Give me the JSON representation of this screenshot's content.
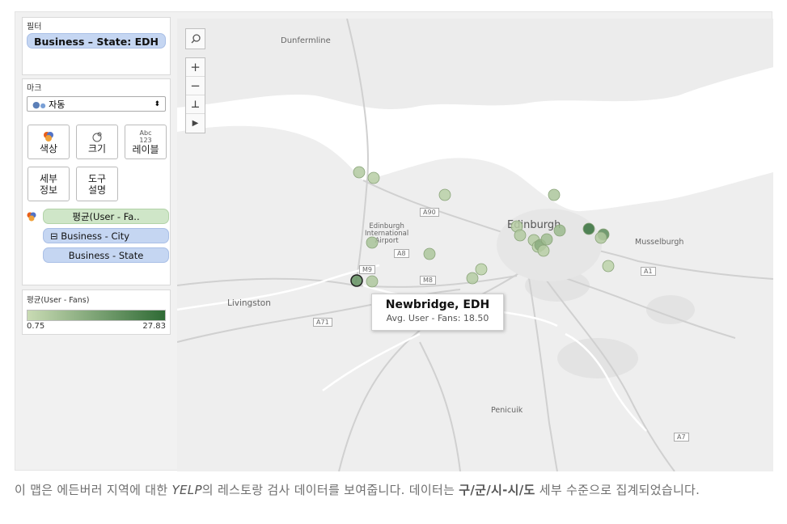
{
  "filters": {
    "title": "필터",
    "pill": "Business – State: EDH"
  },
  "marks": {
    "title": "마크",
    "select_label": "자동",
    "buttons": {
      "color": "색상",
      "size": "크기",
      "label_icon": "Abc\n123",
      "label": "레이블",
      "detail": "세부\n정보",
      "tooltip": "도구\n설명"
    },
    "fields": [
      "평균(User - Fa..",
      "Business - City",
      "Business - State"
    ]
  },
  "legend": {
    "title": "평균(User - Fans)",
    "min": "0.75",
    "max": "27.83",
    "color_low": "#c9dbb4",
    "color_high": "#2f6b35"
  },
  "map_controls": [
    "search-icon",
    "zoom-in",
    "zoom-out",
    "pin",
    "play"
  ],
  "map_labels": {
    "dunfermline": "Dunfermline",
    "edinburgh": "Edinburgh",
    "airport": "Edinburgh\nInternational\nAirport",
    "livingston": "Livingston",
    "musselburgh": "Musselburgh",
    "penicuik": "Penicuik",
    "roads": [
      "A90",
      "A8",
      "M9",
      "M8",
      "A71",
      "A1",
      "A7"
    ]
  },
  "map_data": {
    "points": [
      {
        "city": "Newbridge",
        "state": "EDH",
        "avg_fans": 18.5,
        "selected": true
      },
      {
        "avg_fans": 5.0
      },
      {
        "avg_fans": 4.0
      },
      {
        "avg_fans": 6.5
      },
      {
        "avg_fans": 5.5
      },
      {
        "avg_fans": 6.0
      },
      {
        "avg_fans": 3.5
      },
      {
        "avg_fans": 4.5
      },
      {
        "avg_fans": 3.0
      },
      {
        "avg_fans": 4.0
      },
      {
        "avg_fans": 5.0
      },
      {
        "avg_fans": 4.5
      },
      {
        "avg_fans": 3.5
      },
      {
        "avg_fans": 12.0
      },
      {
        "avg_fans": 27.0
      },
      {
        "avg_fans": 6.0
      },
      {
        "avg_fans": 9.0
      },
      {
        "avg_fans": 20.0
      },
      {
        "avg_fans": 4.0
      },
      {
        "avg_fans": 8.0
      },
      {
        "avg_fans": 3.0
      },
      {
        "avg_fans": 5.0
      }
    ]
  },
  "tooltip": {
    "title": "Newbridge, EDH",
    "line": "Avg. User - Fans:  18.50"
  },
  "caption": {
    "p1": "이 맵은 에든버러 지역에 대한 ",
    "yelp": "YELP",
    "p2": "의 레스토랑 검사 데이터를 보여줍니다. 데이터는 ",
    "bold": "구/군/시-시/도",
    "p3": " 세부 수준으로 집계되었습니다."
  }
}
